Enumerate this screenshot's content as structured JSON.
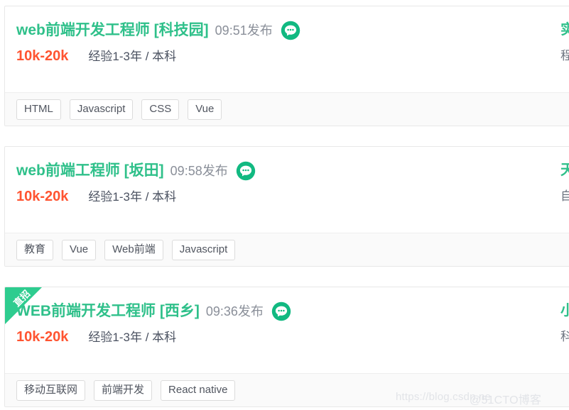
{
  "page": {
    "accent_green": "#2fc08a",
    "salary_color": "#ff5431",
    "meta_gray": "#8a8f99",
    "tag_border": "#dcdcdc",
    "footer_bg": "#fafafa"
  },
  "listings": [
    {
      "ribbon": null,
      "title": "web前端开发工程师 [科技园]",
      "post_time": "09:51发布",
      "chat_icon": "chat-bubble-icon",
      "salary": "10k-20k",
      "requirement": "经验1-3年 / 本科",
      "company_name": "实",
      "company_meta": "程",
      "tags": [
        "HTML",
        "Javascript",
        "CSS",
        "Vue"
      ]
    },
    {
      "ribbon": null,
      "title": "web前端工程师 [坂田]",
      "post_time": "09:58发布",
      "chat_icon": "chat-bubble-icon",
      "salary": "10k-20k",
      "requirement": "经验1-3年 / 本科",
      "company_name": "天",
      "company_meta": "自",
      "tags": [
        "教育",
        "Vue",
        "Web前端",
        "Javascript"
      ]
    },
    {
      "ribbon": "直招",
      "title": "WEB前端开发工程师 [西乡]",
      "post_time": "09:36发布",
      "chat_icon": "chat-bubble-icon",
      "salary": "10k-20k",
      "requirement": "经验1-3年 / 本科",
      "company_name": "小",
      "company_meta": "科",
      "tags": [
        "移动互联网",
        "前端开发",
        "React native"
      ]
    }
  ],
  "watermarks": {
    "url": "https://blog.csdn.ne",
    "site": "@51CTO博客"
  }
}
